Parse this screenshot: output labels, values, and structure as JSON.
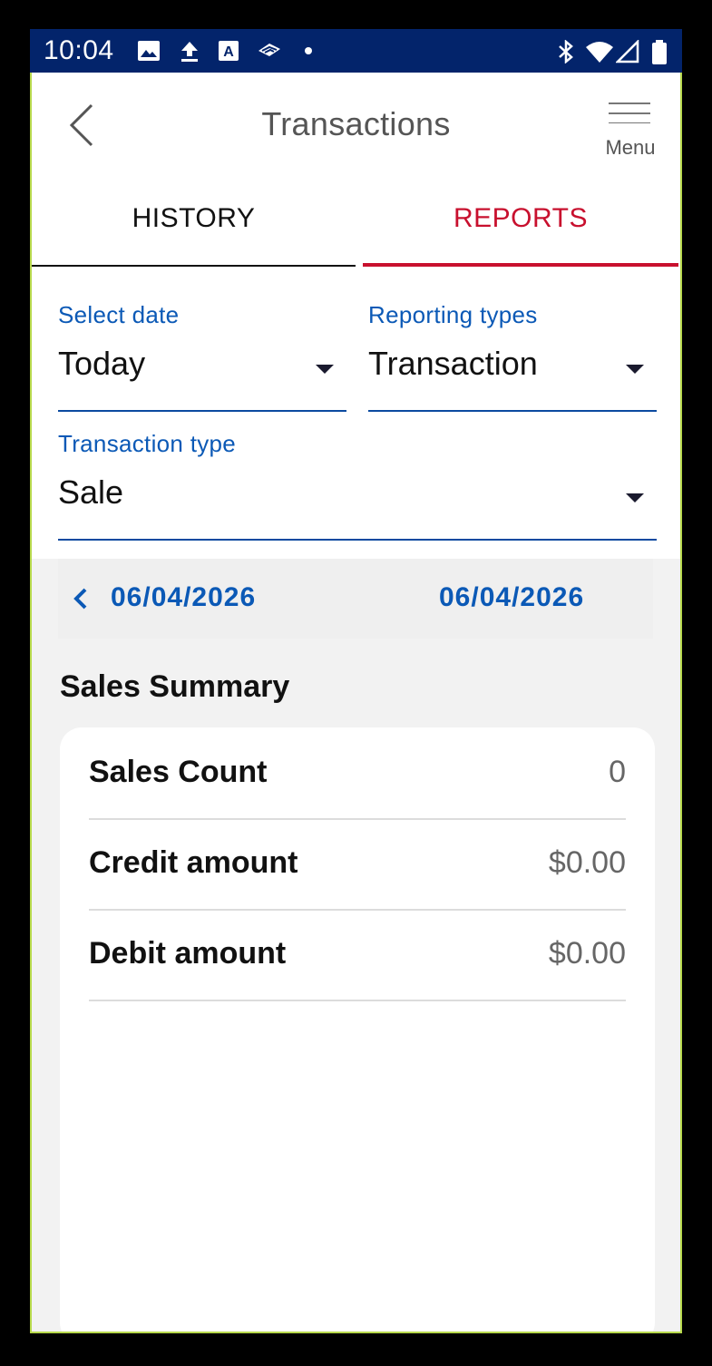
{
  "status_bar": {
    "time": "10:04",
    "left_icons": [
      "image-icon",
      "upload-icon",
      "font-a-icon",
      "bank-icon",
      "dot-icon"
    ],
    "right_icons": [
      "bluetooth-icon",
      "wifi-icon",
      "signal-icon",
      "battery-icon"
    ]
  },
  "app_bar": {
    "title": "Transactions",
    "back_icon": "chevron-left-icon",
    "menu_icon": "hamburger-icon",
    "menu_label": "Menu"
  },
  "tabs": [
    {
      "label": "HISTORY",
      "selected": false
    },
    {
      "label": "REPORTS",
      "selected": true
    }
  ],
  "filters": {
    "select_date": {
      "label": "Select date",
      "value": "Today"
    },
    "reporting_types": {
      "label": "Reporting types",
      "value": "Transaction"
    },
    "transaction_type": {
      "label": "Transaction type",
      "value": "Sale"
    }
  },
  "date_range": {
    "start": "06/04/2026",
    "end": "06/04/2026",
    "prev_icon": "chevron-left-icon"
  },
  "summary": {
    "title": "Sales Summary",
    "rows": [
      {
        "label": "Sales Count",
        "value": "0"
      },
      {
        "label": "Credit amount",
        "value": "$0.00"
      },
      {
        "label": "Debit amount",
        "value": "$0.00"
      }
    ]
  },
  "colors": {
    "status_bar": "#03246b",
    "accent_blue": "#0b59b6",
    "accent_red": "#c8102e",
    "screen_border": "#b7d94c"
  }
}
